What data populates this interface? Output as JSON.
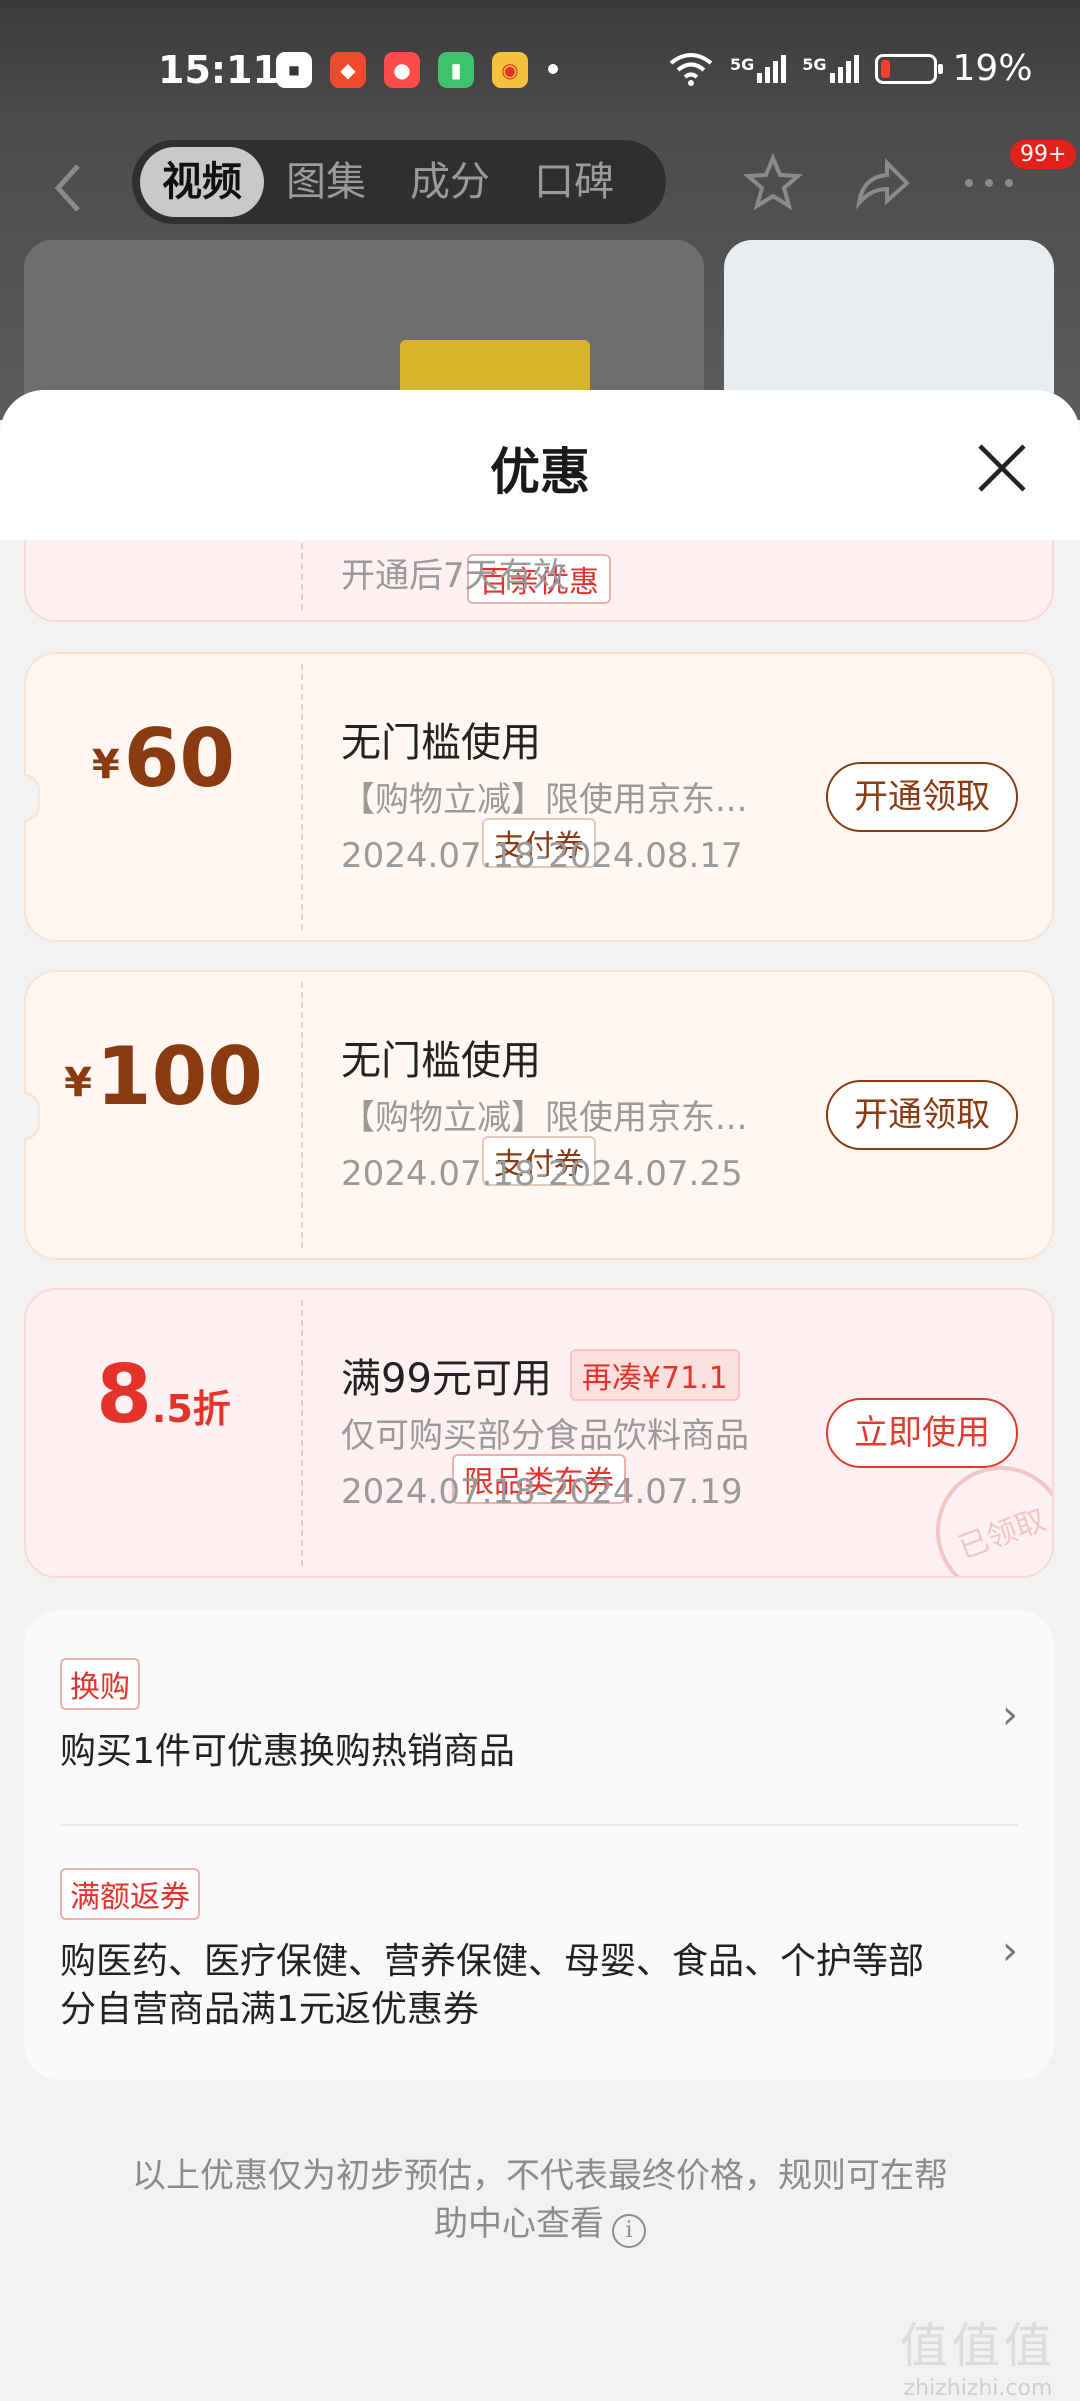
{
  "status_bar": {
    "time": "15:11",
    "battery": "19%",
    "battery_level": 0.19,
    "network_1": "5G",
    "network_2": "5G"
  },
  "nav": {
    "tabs": [
      "视频",
      "图集",
      "成分",
      "口碑"
    ],
    "active_tab": "视频",
    "badge": "99+"
  },
  "sheet": {
    "title": "优惠",
    "partial_tag": "百亲优惠",
    "partial_text": "开通后7天有效",
    "coupons": [
      {
        "amount": "60",
        "currency": "¥",
        "tag": "支付券",
        "title": "无门槛使用",
        "desc": "【购物立减】限使用京东...",
        "date": "2024.07.18-2024.08.17",
        "button": "开通领取"
      },
      {
        "amount": "100",
        "currency": "¥",
        "tag": "支付券",
        "title": "无门槛使用",
        "desc": "【购物立减】限使用京东...",
        "date": "2024.07.18-2024.07.25",
        "button": "开通领取"
      },
      {
        "amount_main": "8",
        "amount_suffix": ".5折",
        "tag": "限品类东券",
        "title": "满99元可用",
        "pill": "再凑¥71.1",
        "desc": "仅可购买部分食品饮料商品",
        "date": "2024.07.18-2024.07.19",
        "button": "立即使用",
        "stamp": "已领取"
      }
    ],
    "promos": [
      {
        "tag": "换购",
        "text": "购买1件可优惠换购热销商品"
      },
      {
        "tag": "满额返券",
        "text": "购医药、医疗保健、营养保健、母婴、食品、个护等部分自营商品满1元返优惠券"
      }
    ],
    "footer_note": "以上优惠仅为初步预估，不代表最终价格，规则可在帮助中心查看"
  },
  "watermark": {
    "logo": "值值值",
    "url": "zhizhizhi.com"
  },
  "colors": {
    "brown": "#8a3b12",
    "red": "#e4332b",
    "sheet_bg": "#f2f2f2"
  }
}
